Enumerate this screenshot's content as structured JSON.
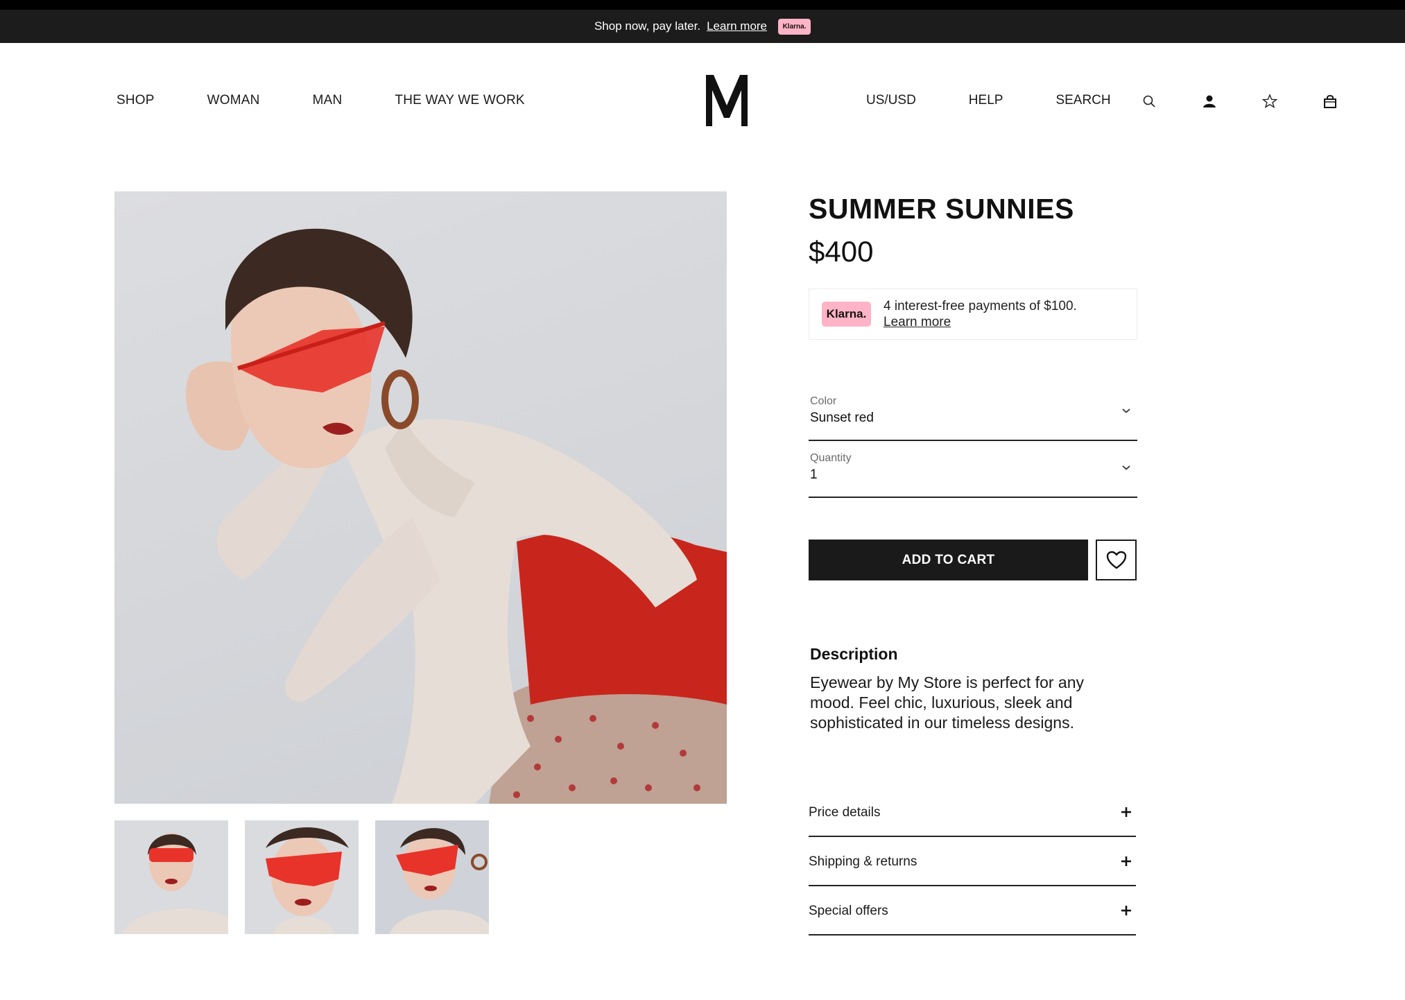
{
  "promo": {
    "text": "Shop now, pay later.",
    "link": "Learn more",
    "badge": "Klarna."
  },
  "header": {
    "nav_left": [
      "SHOP",
      "WOMAN",
      "MAN",
      "THE WAY WE WORK"
    ],
    "logo": "M",
    "nav_right": [
      "US/USD",
      "HELP",
      "SEARCH"
    ],
    "icons": [
      "search-icon",
      "account-icon",
      "star-icon",
      "bag-icon"
    ]
  },
  "gallery": {
    "thumbnails": 3
  },
  "product": {
    "title": "SUMMER SUNNIES",
    "price": "$400",
    "klarna": {
      "badge": "Klarna.",
      "text": "4 interest-free payments of $100.",
      "link": "Learn more",
      "badge_color": "#ffb3c7"
    },
    "color_field": {
      "label": "Color",
      "value": "Sunset red"
    },
    "quantity_field": {
      "label": "Quantity",
      "value": "1"
    },
    "add_to_cart": "ADD TO CART",
    "description": {
      "heading": "Description",
      "body": "Eyewear by My Store is perfect for any mood. Feel chic, luxurious, sleek and sophisticated in our timeless designs."
    },
    "accordion": [
      {
        "label": "Price details"
      },
      {
        "label": "Shipping & returns"
      },
      {
        "label": "Special offers"
      }
    ]
  }
}
